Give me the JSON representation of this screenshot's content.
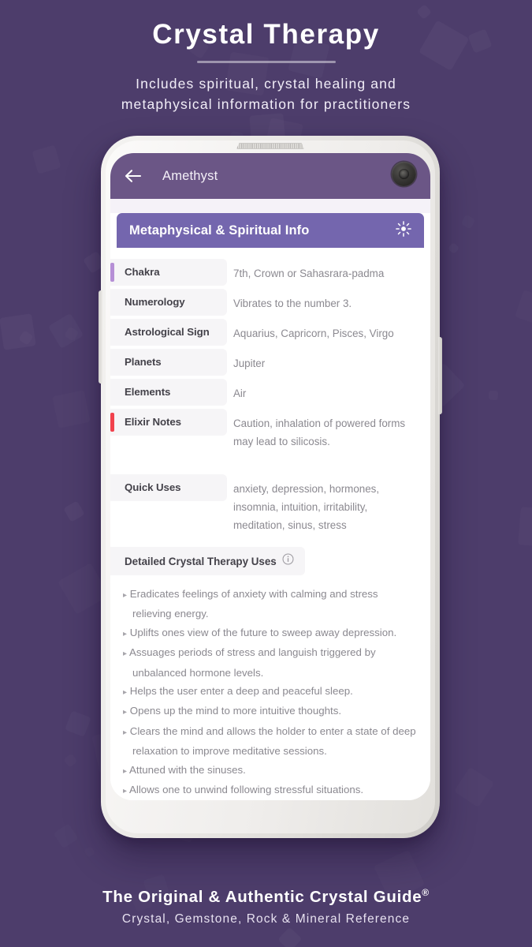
{
  "promo": {
    "title": "Crystal Therapy",
    "subtitle_line1": "Includes spiritual, crystal healing and",
    "subtitle_line2": "metaphysical information for practitioners",
    "footer_title": "The Original & Authentic Crystal Guide",
    "footer_title_sup": "®",
    "footer_subtitle": "Crystal, Gemstone, Rock & Mineral Reference"
  },
  "colors": {
    "background_purple": "#4d3d6b",
    "appbar_purple": "#6b5686",
    "section_header_purple": "#7466ae",
    "accent_chakra": "#b68fd6",
    "accent_elixir": "#f1424d",
    "label_text": "#44424a",
    "value_text": "#8b8990"
  },
  "phone": {
    "speaker_icon": "speaker-grille-icon",
    "camera_icon": "front-camera-icon",
    "volume_button": "volume-button",
    "power_button": "power-button"
  },
  "appbar": {
    "back_icon": "back-arrow-icon",
    "title": "Amethyst"
  },
  "section": {
    "header_title": "Metaphysical & Spiritual Info",
    "header_icon": "sun-brightness-icon"
  },
  "table": {
    "rows": [
      {
        "label": "Chakra",
        "value": "7th, Crown or Sahasrara-padma",
        "accent": "#b68fd6"
      },
      {
        "label": "Numerology",
        "value": "Vibrates to the number 3.",
        "accent": ""
      },
      {
        "label": "Astrological Sign",
        "value": "Aquarius, Capricorn, Pisces, Virgo",
        "accent": ""
      },
      {
        "label": "Planets",
        "value": "Jupiter",
        "accent": ""
      },
      {
        "label": "Elements",
        "value": "Air",
        "accent": ""
      },
      {
        "label": "Elixir Notes",
        "value": "Caution, inhalation of powered forms may lead to silicosis.",
        "accent": "#f1424d"
      },
      {
        "label": "Quick Uses",
        "value": "anxiety, depression, hormones, insomnia, intuition, irritability, meditation, sinus, stress",
        "accent": ""
      }
    ]
  },
  "detailed": {
    "header": "Detailed Crystal Therapy Uses",
    "info_icon": "info-circle-icon",
    "bullet_mark": "▸",
    "items": [
      "Eradicates feelings of anxiety with calming and stress relieving energy.",
      "Uplifts ones view of the future to sweep away depression.",
      "Assuages periods of stress and languish triggered by unbalanced hormone levels.",
      "Helps the user enter a deep and peaceful sleep.",
      "Opens up the mind to more intuitive thoughts.",
      "Clears the mind and allows the holder to enter a state of deep relaxation to improve meditative sessions.",
      "Attuned with the sinuses.",
      "Allows one to unwind following stressful situations."
    ]
  }
}
